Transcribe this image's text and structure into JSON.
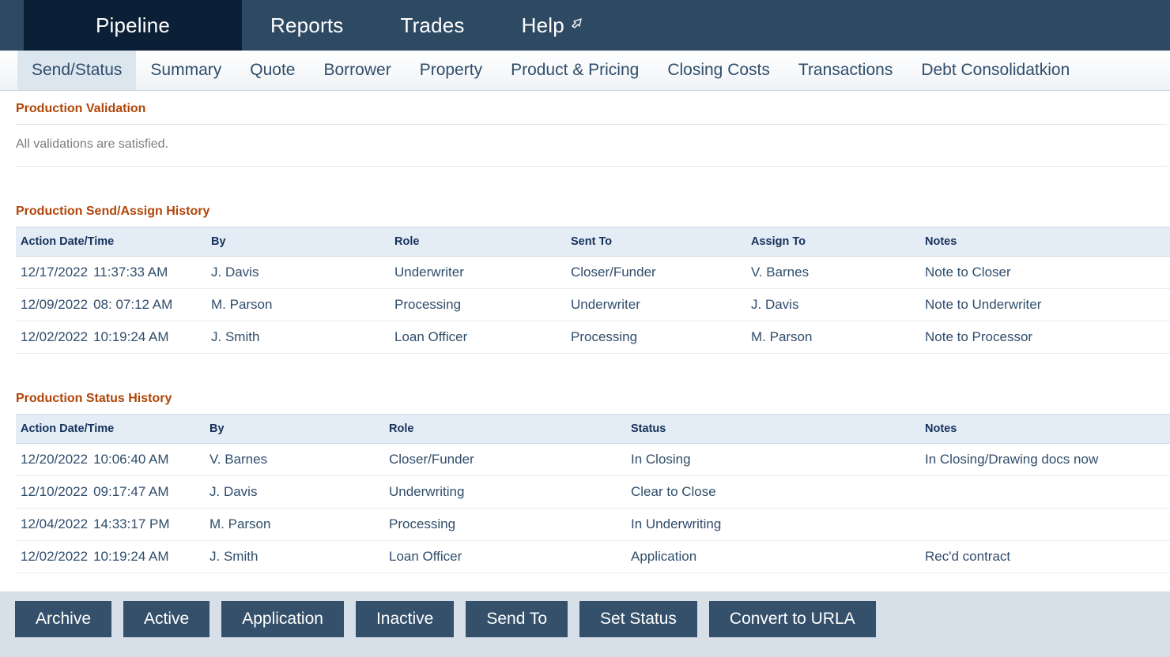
{
  "top_nav": {
    "tabs": [
      {
        "label": "Pipeline",
        "active": true,
        "icon": null
      },
      {
        "label": "Reports",
        "active": false,
        "icon": null
      },
      {
        "label": "Trades",
        "active": false,
        "icon": null
      },
      {
        "label": "Help",
        "active": false,
        "icon": "external-link-icon"
      }
    ]
  },
  "sub_tabs": {
    "items": [
      {
        "label": "Send/Status",
        "active": true
      },
      {
        "label": "Summary",
        "active": false
      },
      {
        "label": "Quote",
        "active": false
      },
      {
        "label": "Borrower",
        "active": false
      },
      {
        "label": "Property",
        "active": false
      },
      {
        "label": "Product & Pricing",
        "active": false
      },
      {
        "label": "Closing Costs",
        "active": false
      },
      {
        "label": "Transactions",
        "active": false
      },
      {
        "label": "Debt Consolidatkion",
        "active": false
      }
    ]
  },
  "validation": {
    "title": "Production Validation",
    "message": "All validations are satisfied."
  },
  "send_assign_history": {
    "title": "Production Send/Assign History",
    "columns": [
      "Action Date/Time",
      "By",
      "Role",
      "Sent To",
      "Assign To",
      "Notes"
    ],
    "rows": [
      {
        "date": "12/17/2022",
        "time": "11:37:33 AM",
        "by": "J. Davis",
        "role": "Underwriter",
        "sent_to": "Closer/Funder",
        "assign_to": "V. Barnes",
        "notes": "Note to Closer"
      },
      {
        "date": "12/09/2022",
        "time": "08: 07:12 AM",
        "by": "M. Parson",
        "role": "Processing",
        "sent_to": "Underwriter",
        "assign_to": "J. Davis",
        "notes": "Note to Underwriter"
      },
      {
        "date": "12/02/2022",
        "time": "10:19:24 AM",
        "by": "J. Smith",
        "role": "Loan Officer",
        "sent_to": "Processing",
        "assign_to": "M. Parson",
        "notes": "Note to Processor"
      }
    ]
  },
  "status_history": {
    "title": "Production Status History",
    "columns": [
      "Action Date/Time",
      "By",
      "Role",
      "Status",
      "Notes"
    ],
    "rows": [
      {
        "date": "12/20/2022",
        "time": "10:06:40 AM",
        "by": "V. Barnes",
        "role": "Closer/Funder",
        "status": "In Closing",
        "notes": "In Closing/Drawing docs now"
      },
      {
        "date": "12/10/2022",
        "time": "09:17:47 AM",
        "by": "J. Davis",
        "role": "Underwriting",
        "status": "Clear to Close",
        "notes": ""
      },
      {
        "date": "12/04/2022",
        "time": "14:33:17 PM",
        "by": "M. Parson",
        "role": "Processing",
        "status": "In Underwriting",
        "notes": ""
      },
      {
        "date": "12/02/2022",
        "time": "10:19:24 AM",
        "by": "J. Smith",
        "role": "Loan Officer",
        "status": "Application",
        "notes": "Rec'd contract"
      }
    ]
  },
  "footer": {
    "buttons": [
      "Archive",
      "Active",
      "Application",
      "Inactive",
      "Send To",
      "Set Status",
      "Convert to URLA"
    ]
  },
  "colors": {
    "nav_bar": "#2e4a63",
    "nav_active": "#0b2037",
    "subtab_active": "#dce6ef",
    "section_heading": "#b1450a",
    "table_header": "#e4ecf5",
    "body_text": "#2f4d6b",
    "footer_bar": "#d7e0e8",
    "button": "#34506b"
  }
}
